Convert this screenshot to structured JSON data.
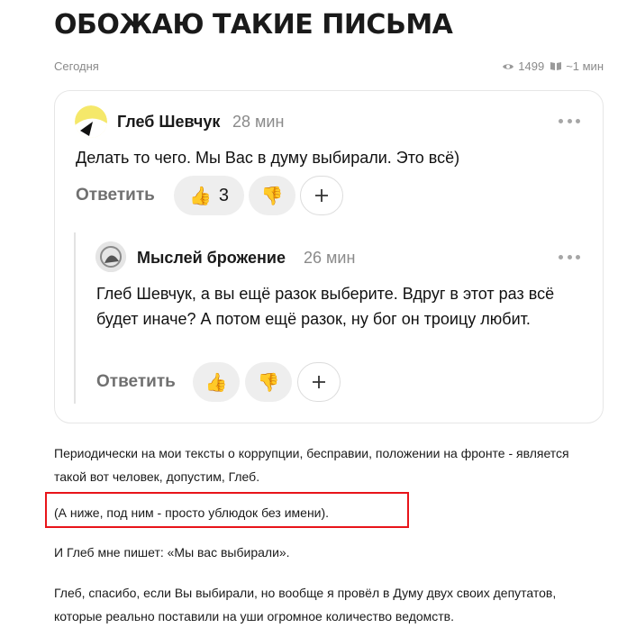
{
  "article": {
    "title": "ОБОЖАЮ ТАКИЕ ПИСЬМА",
    "date": "Сегодня",
    "views": "1499",
    "read_time": "~1 мин"
  },
  "comment": {
    "author": "Глеб Шевчук",
    "time": "28 мин",
    "text": "Делать то чего. Мы Вас в думу выбирали. Это всё)",
    "reply_label": "Ответить",
    "like_count": "3"
  },
  "reply": {
    "author": "Мыслей брожение",
    "time": "26 мин",
    "text": "Глеб Шевчук, а вы ещё разок выберите. Вдруг в этот раз всё будет иначе? А потом ещё разок, ну бог он троицу любит.",
    "reply_label": "Ответить"
  },
  "body": {
    "p1": "Периодически на мои тексты о коррупции, бесправии, положении на фронте - является такой вот человек, допустим, Глеб.",
    "p2": "(А ниже, под ним - просто ублюдок без имени).",
    "p3": "И Глеб мне пишет: «Мы вас выбирали».",
    "p4": "Глеб, спасибо, если Вы выбирали, но вообще я провёл в Думу двух своих депутатов, которые реально поставили на уши огромное количество ведомств."
  },
  "colors": {
    "highlight_border": "#e8141a",
    "muted_text": "#8a8a8a"
  },
  "icons": {
    "views": "eye-icon",
    "read_time": "book-icon",
    "like": "thumbs-up-emoji",
    "dislike": "thumbs-down-emoji",
    "add_reaction": "plus-icon",
    "more": "more-dots-icon"
  }
}
